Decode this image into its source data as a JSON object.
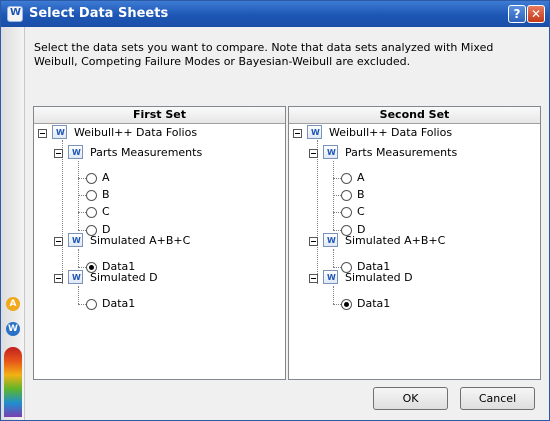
{
  "window": {
    "title": "Select Data Sheets",
    "help_label": "?",
    "close_label": "✕"
  },
  "instructions": "Select the data sets you want to compare. Note that data sets analyzed with Mixed Weibull, Competing Failure Modes or Bayesian-Weibull are excluded.",
  "first_set": {
    "header": "First Set",
    "root": "Weibull++ Data Folios",
    "folio1": "Parts Measurements",
    "folio1_sheets": [
      "A",
      "B",
      "C",
      "D"
    ],
    "folio2": "Simulated A+B+C",
    "folio2_sheets": [
      "Data1"
    ],
    "folio3": "Simulated D",
    "folio3_sheets": [
      "Data1"
    ],
    "selected": "Simulated A+B+C / Data1"
  },
  "second_set": {
    "header": "Second Set",
    "root": "Weibull++ Data Folios",
    "folio1": "Parts Measurements",
    "folio1_sheets": [
      "A",
      "B",
      "C",
      "D"
    ],
    "folio2": "Simulated A+B+C",
    "folio2_sheets": [
      "Data1"
    ],
    "folio3": "Simulated D",
    "folio3_sheets": [
      "Data1"
    ],
    "selected": "Simulated D / Data1"
  },
  "buttons": {
    "ok": "OK",
    "cancel": "Cancel"
  },
  "colors": {
    "titlebar": "#1d56b4",
    "panel_border": "#828790"
  }
}
